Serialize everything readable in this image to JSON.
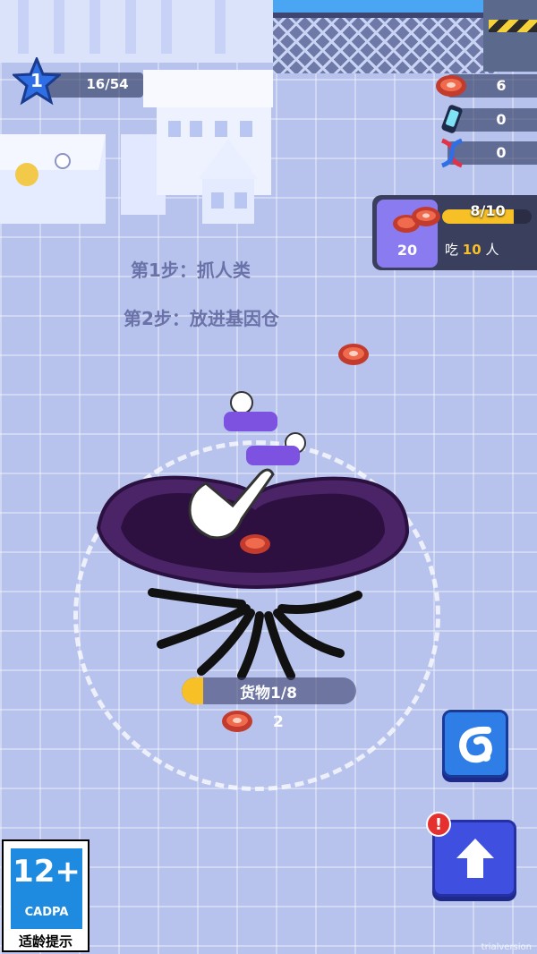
{
  "hud": {
    "level": "1",
    "level_progress": "16/54",
    "resources": [
      {
        "icon": "meat-icon",
        "value": "6"
      },
      {
        "icon": "battery-icon",
        "value": "0"
      },
      {
        "icon": "dna-icon",
        "value": "0"
      }
    ]
  },
  "eat_panel": {
    "progress": "8/10",
    "progress_fraction": 0.8,
    "count": "20",
    "text_prefix": "吃",
    "text_num": "10",
    "text_suffix": "人"
  },
  "tutorial": {
    "step1": "第1步：抓人类",
    "step2": "第2步：放进基因仓"
  },
  "cargo": {
    "label": "货物1/8",
    "fill_fraction": 0.125,
    "meat_count": "2"
  },
  "buttons": {
    "skill": "swirl-icon",
    "upgrade": "arrow-up-icon",
    "alert": "!"
  },
  "badge": {
    "age": "12+",
    "org": "CADPA",
    "tip": "适龄提示"
  },
  "watermark": "trialversion",
  "colors": {
    "accent_yellow": "#f6c026",
    "panel_purple": "#8a7cf0",
    "button_blue": "#2f7de6"
  }
}
